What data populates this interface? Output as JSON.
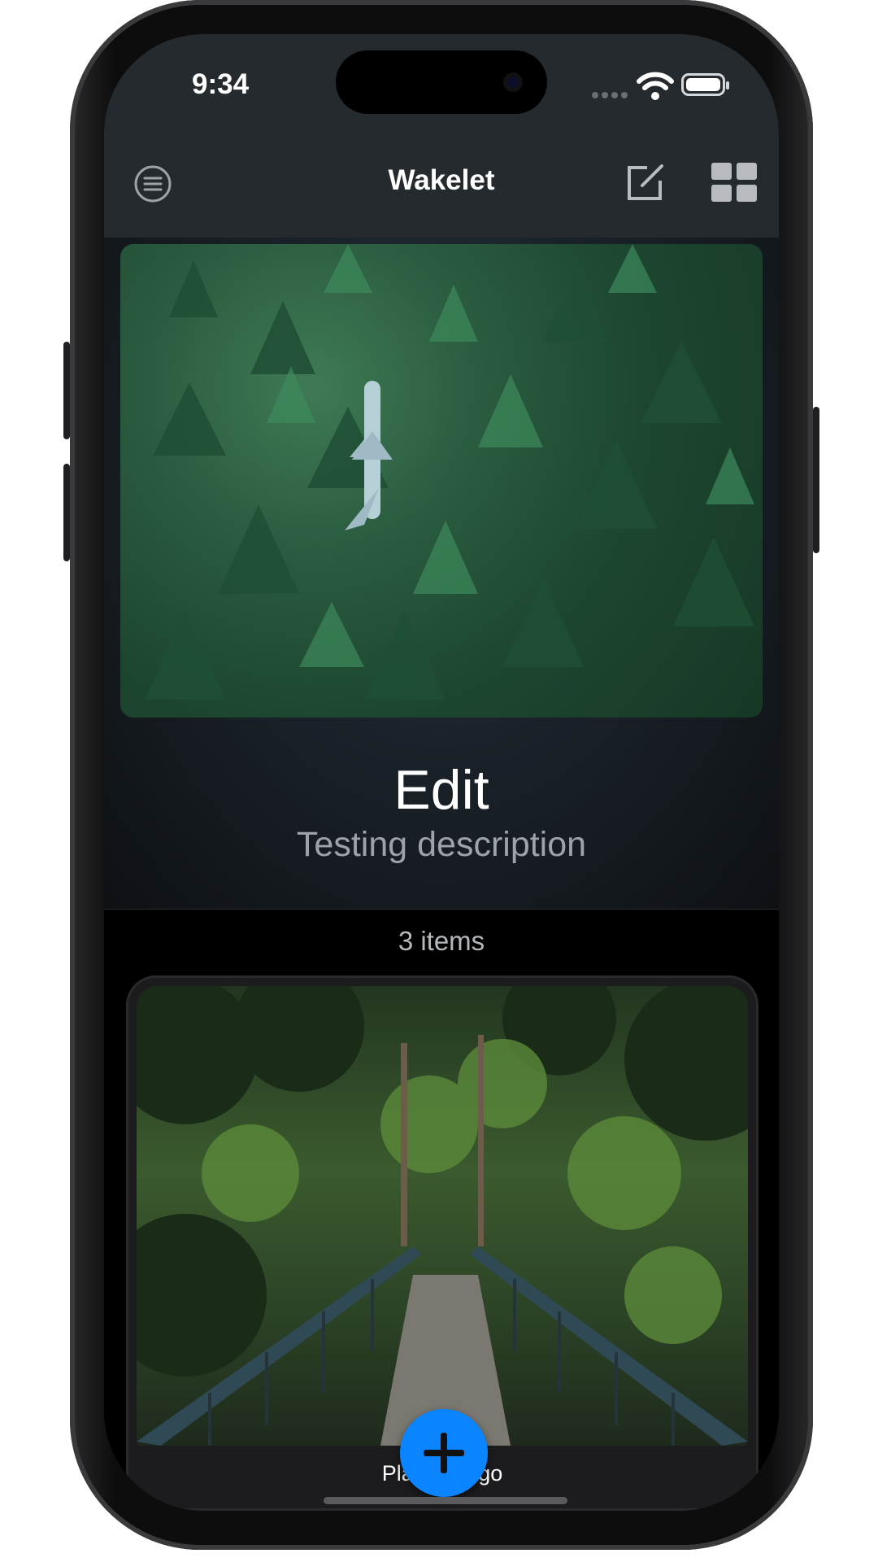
{
  "status_bar": {
    "time": "9:34"
  },
  "nav": {
    "title": "Wakelet"
  },
  "collection": {
    "title": "Edit",
    "description": "Testing description",
    "items_count": "3 items"
  },
  "card": {
    "caption": "Places to go"
  },
  "colors": {
    "accent": "#0a84ff",
    "nav_bg": "#242a2e",
    "card_bg": "#1c1c1e"
  },
  "icons": {
    "menu": "menu-icon",
    "edit": "compose-icon",
    "layout": "grid-icon",
    "add": "plus-icon"
  }
}
